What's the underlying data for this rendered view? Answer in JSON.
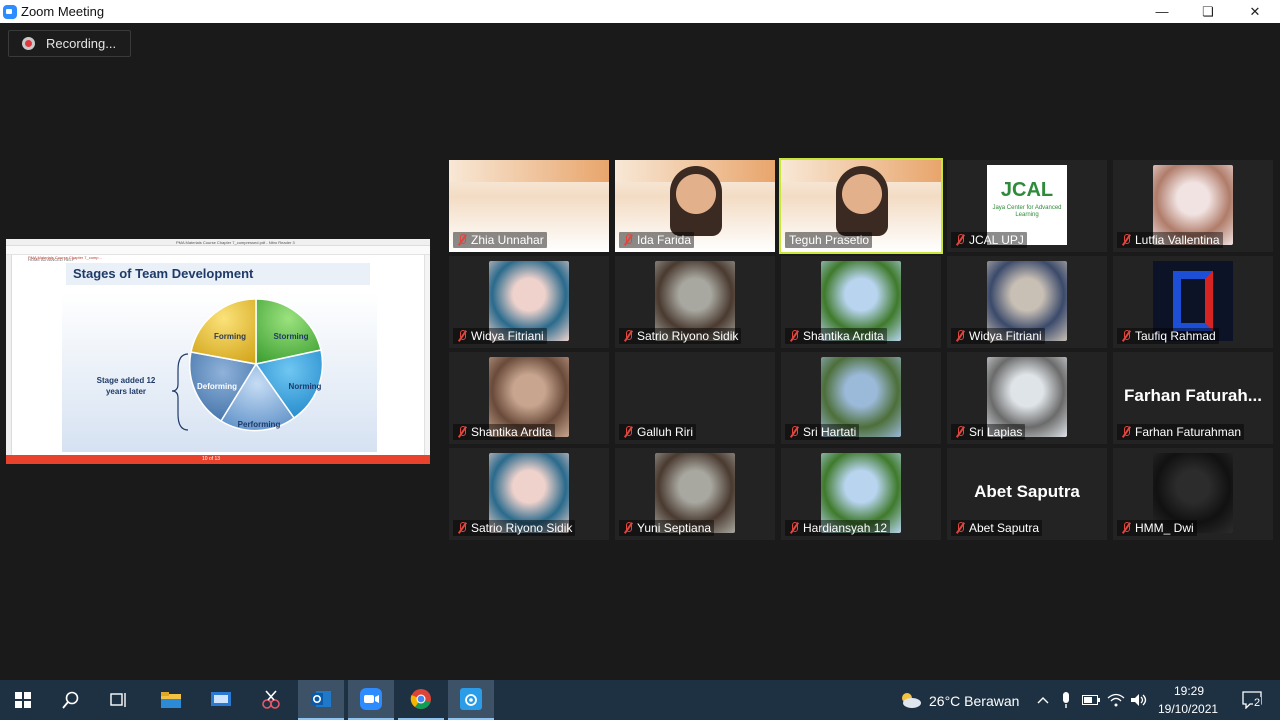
{
  "window": {
    "title": "Zoom Meeting"
  },
  "recording": {
    "label": "Recording..."
  },
  "shared_screen": {
    "pdf_title": "PMA Materials Course Chapter 7_compressed.pdf - Nitro Reader 3",
    "ribbon_tabs": "HOME    ADVANCED    HELP",
    "tab_label": "PMA Materials Course Chapter 7_comp...",
    "slide_title": "Stages of Team Development",
    "stage_added": "Stage added 12 years later",
    "segments": [
      "Forming",
      "Storming",
      "Norming",
      "Performing",
      "Deforming"
    ],
    "page_indicator": "10 of 13"
  },
  "participants": [
    {
      "name": "Zhia Unnahar",
      "muted": true,
      "kind": "slide"
    },
    {
      "name": "Ida Farida",
      "muted": true,
      "kind": "slide-face"
    },
    {
      "name": "Teguh Prasetio",
      "muted": false,
      "kind": "slide-face",
      "active": true
    },
    {
      "name": "JCAL UPJ",
      "muted": true,
      "kind": "logo"
    },
    {
      "name": "Lutfia Vallentina",
      "muted": true,
      "kind": "photo"
    },
    {
      "name": "Widya Fitriani",
      "muted": true,
      "kind": "photo"
    },
    {
      "name": "Satrio Riyono Sidik",
      "muted": true,
      "kind": "photo"
    },
    {
      "name": "Shantika Ardita",
      "muted": true,
      "kind": "photo"
    },
    {
      "name": "Widya Fitriani",
      "muted": true,
      "kind": "photo"
    },
    {
      "name": "Taufiq Rahmad",
      "muted": true,
      "kind": "logo"
    },
    {
      "name": "Shantika Ardita",
      "muted": true,
      "kind": "photo"
    },
    {
      "name": "Galluh Riri",
      "muted": true,
      "kind": "empty"
    },
    {
      "name": "Sri Hartati",
      "muted": true,
      "kind": "photo"
    },
    {
      "name": "Sri Lapias",
      "muted": true,
      "kind": "photo"
    },
    {
      "name": "Farhan Faturahman",
      "muted": true,
      "kind": "text",
      "big": "Farhan  Faturah..."
    },
    {
      "name": "Satrio Riyono Sidik",
      "muted": true,
      "kind": "photo"
    },
    {
      "name": "Yuni Septiana",
      "muted": true,
      "kind": "photo"
    },
    {
      "name": "Hardiansyah 12",
      "muted": true,
      "kind": "photo"
    },
    {
      "name": "Abet Saputra",
      "muted": true,
      "kind": "text",
      "big": "Abet Saputra"
    },
    {
      "name": "HMM_ Dwi",
      "muted": true,
      "kind": "photo"
    }
  ],
  "jcal_logo": {
    "line1": "JCAL",
    "line2": "Jaya Center for Advanced Learning"
  },
  "taskbar": {
    "weather": "26°C  Berawan",
    "time": "19:29",
    "date": "19/10/2021",
    "notification_count": "2"
  },
  "colors": {
    "active_speaker": "#c8e63c",
    "muted_mic": "#e0463e",
    "taskbar": "#1e3143"
  }
}
